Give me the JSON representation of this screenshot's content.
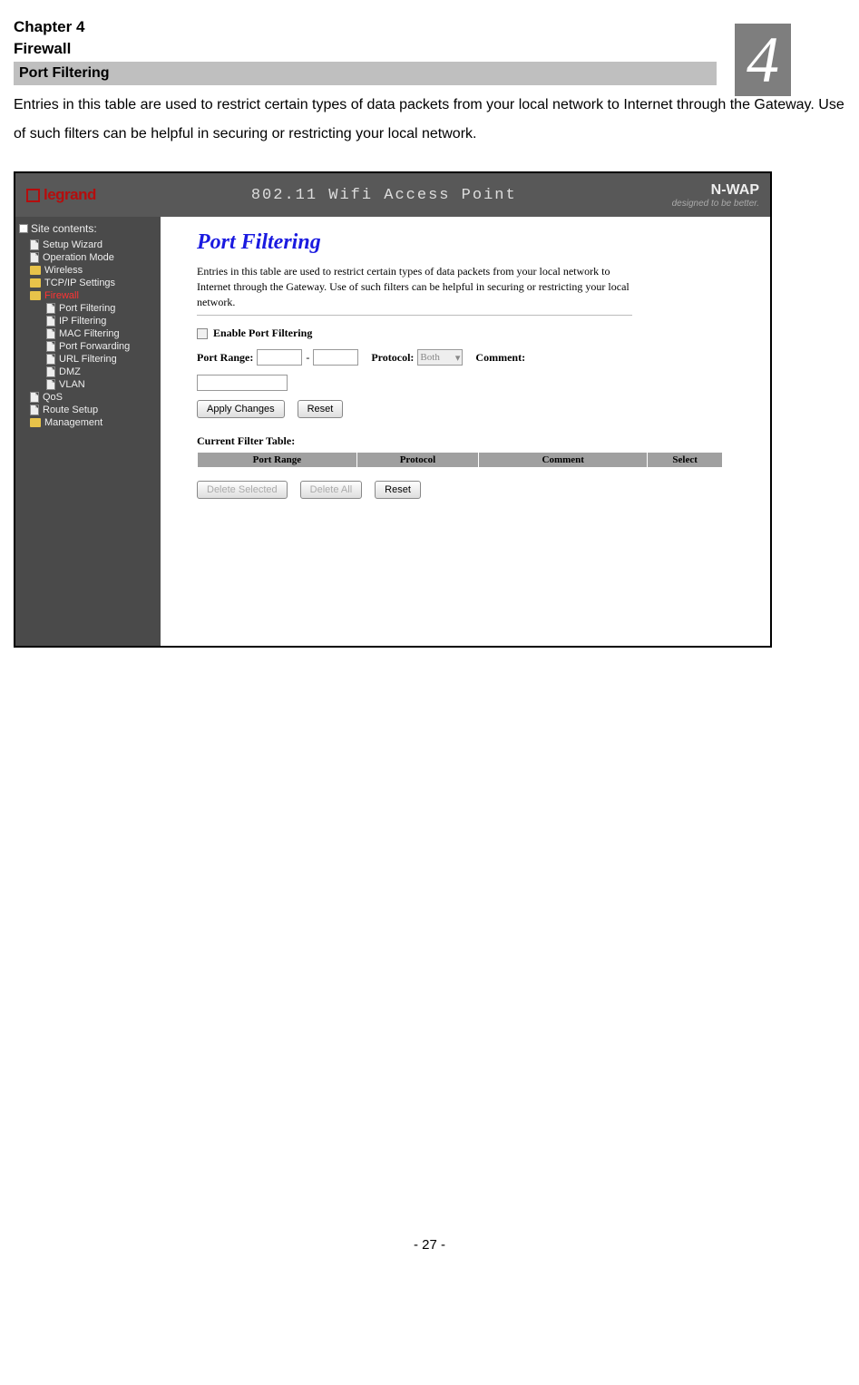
{
  "doc": {
    "chapter": "Chapter 4",
    "title": "Firewall",
    "section": "Port Filtering",
    "body": "Entries in this table are used to restrict certain types of data packets from your local network to Internet through the Gateway. Use of such filters can be helpful in securing or restricting your local network.",
    "big_number": "4",
    "page_num": "- 27 -"
  },
  "topbar": {
    "logo_text": "legrand",
    "center": "802.11 Wifi Access Point",
    "brand": "N-WAP",
    "tagline": "designed to be better."
  },
  "sidebar": {
    "heading": "Site contents:",
    "items": [
      {
        "label": "Setup Wizard",
        "type": "doc"
      },
      {
        "label": "Operation Mode",
        "type": "doc"
      },
      {
        "label": "Wireless",
        "type": "folder"
      },
      {
        "label": "TCP/IP Settings",
        "type": "folder"
      },
      {
        "label": "Firewall",
        "type": "folder",
        "active": true
      },
      {
        "label": "Port Filtering",
        "type": "sub"
      },
      {
        "label": "IP Filtering",
        "type": "sub"
      },
      {
        "label": "MAC Filtering",
        "type": "sub"
      },
      {
        "label": "Port Forwarding",
        "type": "sub"
      },
      {
        "label": "URL Filtering",
        "type": "sub"
      },
      {
        "label": "DMZ",
        "type": "sub"
      },
      {
        "label": "VLAN",
        "type": "sub"
      },
      {
        "label": "QoS",
        "type": "doc"
      },
      {
        "label": "Route Setup",
        "type": "doc"
      },
      {
        "label": "Management",
        "type": "folder"
      }
    ]
  },
  "panel": {
    "title": "Port Filtering",
    "desc": "Entries in this table are used to restrict certain types of data packets from your local network to Internet through the Gateway. Use of such filters can be helpful in securing or restricting your local network.",
    "enable_label": "Enable Port Filtering",
    "port_range_label": "Port Range:",
    "protocol_label": "Protocol:",
    "protocol_value": "Both",
    "comment_label": "Comment:",
    "apply": "Apply Changes",
    "reset": "Reset",
    "table_title": "Current Filter Table:",
    "cols": [
      "Port Range",
      "Protocol",
      "Comment",
      "Select"
    ],
    "delete_selected": "Delete Selected",
    "delete_all": "Delete All",
    "reset2": "Reset"
  }
}
